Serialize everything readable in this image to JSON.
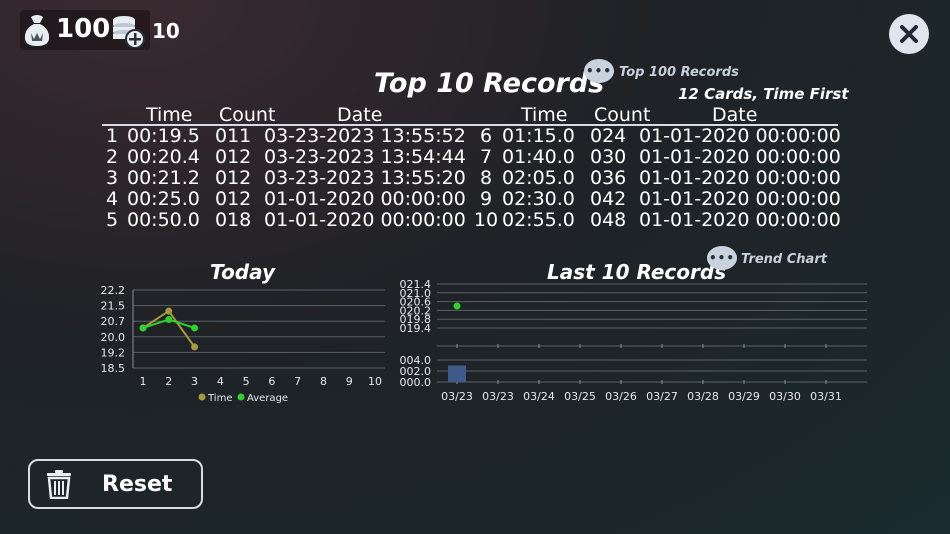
{
  "hud": {
    "bag_value": "100",
    "coin_value": "10",
    "bag_icon": "money-bag-icon",
    "coin_icon": "coin-stack-add-icon"
  },
  "records": {
    "title": "Top 10 Records",
    "top100_link": "Top 100 Records",
    "subtitle": "12 Cards, Time First",
    "headers": {
      "time": "Time",
      "count": "Count",
      "date": "Date"
    },
    "rows": [
      {
        "rank": "1",
        "time": "00:19.5",
        "count": "011",
        "date": "03-23-2023 13:55:52"
      },
      {
        "rank": "2",
        "time": "00:20.4",
        "count": "012",
        "date": "03-23-2023 13:54:44"
      },
      {
        "rank": "3",
        "time": "00:21.2",
        "count": "012",
        "date": "03-23-2023 13:55:20"
      },
      {
        "rank": "4",
        "time": "00:25.0",
        "count": "012",
        "date": "01-01-2020 00:00:00"
      },
      {
        "rank": "5",
        "time": "00:50.0",
        "count": "018",
        "date": "01-01-2020 00:00:00"
      },
      {
        "rank": "6",
        "time": "01:15.0",
        "count": "024",
        "date": "01-01-2020 00:00:00"
      },
      {
        "rank": "7",
        "time": "01:40.0",
        "count": "030",
        "date": "01-01-2020 00:00:00"
      },
      {
        "rank": "8",
        "time": "02:05.0",
        "count": "036",
        "date": "01-01-2020 00:00:00"
      },
      {
        "rank": "9",
        "time": "02:30.0",
        "count": "042",
        "date": "01-01-2020 00:00:00"
      },
      {
        "rank": "10",
        "time": "02:55.0",
        "count": "048",
        "date": "01-01-2020 00:00:00"
      }
    ]
  },
  "today_chart": {
    "title": "Today",
    "yticks": [
      "22.2",
      "21.5",
      "20.7",
      "20.0",
      "19.2",
      "18.5"
    ],
    "xticks": [
      "1",
      "2",
      "3",
      "4",
      "5",
      "6",
      "7",
      "8",
      "9",
      "10"
    ],
    "legend": [
      "Time",
      "Average"
    ],
    "colors": {
      "time": "#a89a3c",
      "average": "#2fd12f"
    }
  },
  "last10_chart": {
    "title": "Last 10 Records",
    "trend_link": "Trend Chart",
    "top_yticks": [
      "021.4",
      "021.0",
      "020.6",
      "020.2",
      "019.8",
      "019.4"
    ],
    "bottom_yticks": [
      "004.0",
      "002.0",
      "000.0"
    ],
    "xticks": [
      "03/23",
      "03/23",
      "03/24",
      "03/25",
      "03/26",
      "03/27",
      "03/28",
      "03/29",
      "03/30",
      "03/31"
    ],
    "colors": {
      "point": "#2fd12f",
      "bar": "#3f5a8c"
    }
  },
  "chart_data": [
    {
      "type": "line",
      "title": "Today",
      "x": [
        1,
        2,
        3
      ],
      "series": [
        {
          "name": "Time",
          "values": [
            20.4,
            21.2,
            19.5
          ]
        },
        {
          "name": "Average",
          "values": [
            20.4,
            20.8,
            20.4
          ]
        }
      ],
      "ylim": [
        18.5,
        22.2
      ],
      "xlim": [
        1,
        10
      ],
      "legend": "bottom"
    },
    {
      "type": "scatter",
      "title": "Last 10 Records",
      "categories": [
        "03/23"
      ],
      "series": [
        {
          "values": [
            20.4
          ]
        }
      ],
      "ylim": [
        19.4,
        21.4
      ]
    },
    {
      "type": "bar",
      "title": "Last 10 Records",
      "categories": [
        "03/23"
      ],
      "values": [
        3
      ],
      "ylim": [
        0,
        4
      ]
    }
  ],
  "reset": {
    "label": "Reset"
  }
}
